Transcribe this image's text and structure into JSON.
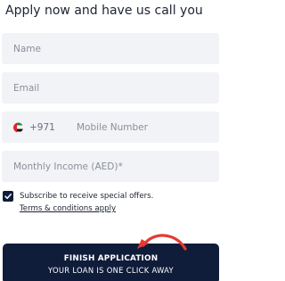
{
  "form": {
    "heading": "Apply now and have us call you",
    "name_placeholder": "Name",
    "email_placeholder": "Email",
    "country_code": "+971",
    "mobile_placeholder": "Mobile Number",
    "income_placeholder": "Monthly Income (AED)*",
    "consent": {
      "checked": true,
      "label": "Subscribe to receive special offers.",
      "terms_link": "Terms & conditions apply"
    },
    "submit": {
      "title": "FINISH APPLICATION",
      "subtitle": "YOUR LOAN IS ONE CLICK AWAY"
    }
  },
  "icons": {
    "flag": "uae-flag-icon",
    "checkmark": "checkmark-icon",
    "arrow": "curved-arrow-icon"
  },
  "colors": {
    "primary": "#0f1c3a",
    "field_bg": "#f2f3f6",
    "arrow": "#e53a32",
    "text": "#1d2333"
  }
}
